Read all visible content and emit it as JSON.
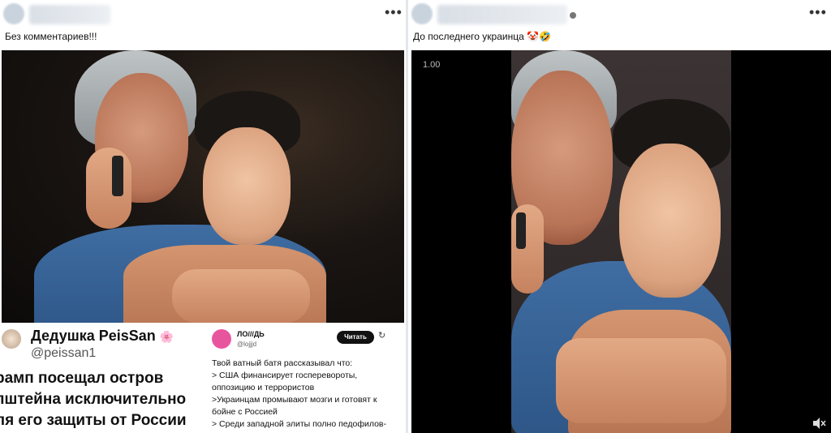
{
  "left_post": {
    "caption": "Без комментариев!!!",
    "more_label": "•••",
    "tweet_left": {
      "name": "Дедушка PeisSan",
      "name_emoji": "🌸",
      "handle": "@peissan1",
      "lines": [
        "рамп посещал остров",
        "пштейна исключительно",
        "ля его защиты от России"
      ]
    },
    "tweet_right": {
      "name": "ЛО///ДЬ",
      "handle": "@lojjjd",
      "button": "Читать",
      "refresh_icon": "↻",
      "lines": [
        "Твой ватный батя рассказывал что:",
        "> США  финансирует госперевороты,",
        "оппозицию и террористов",
        ">Украинцам промывают мозги и готовят к",
        "бойне с Россией",
        "> Среди западной элиты полно педофилов-"
      ]
    }
  },
  "right_post": {
    "caption": "До последнего украинца 🤡🤣",
    "more_label": "•••",
    "video": {
      "timestamp": "1.00"
    }
  }
}
